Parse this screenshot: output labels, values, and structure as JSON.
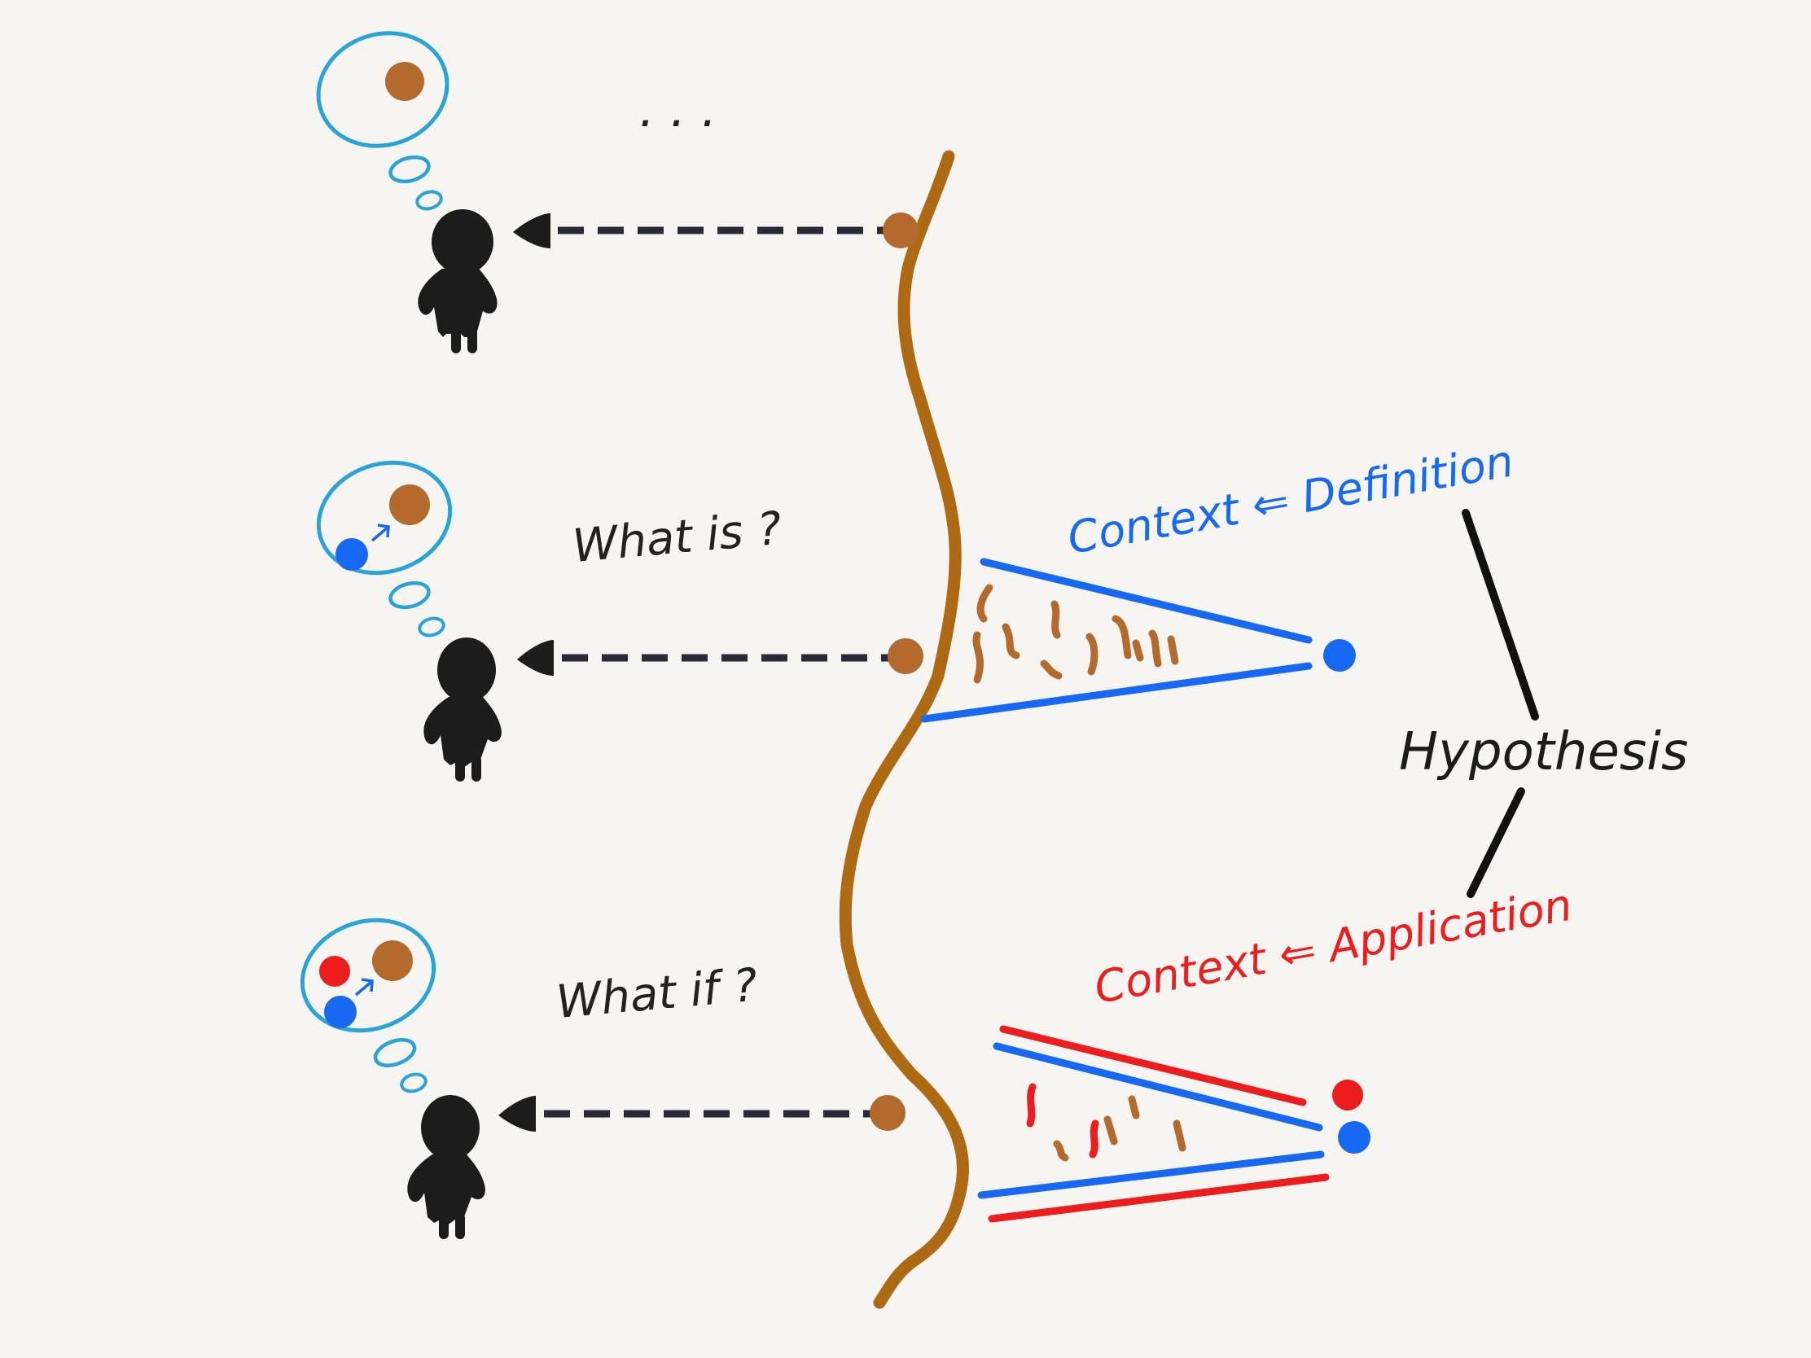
{
  "colors": {
    "background": "#f6f5f1",
    "river": "#ad6a12",
    "dot_brown": "#b36a2c",
    "blue": "#1768f2",
    "red": "#ee1d1d",
    "bubble": "#2aa3d8",
    "figure": "#1c1c1c",
    "arrow": "#2a2a36"
  },
  "labels": {
    "ellipsis": ". . .",
    "what_is": "What is ?",
    "what_if": "What if ?",
    "context_definition": "Context ⇐ Definition",
    "hypothesis": "Hypothesis",
    "context_application": "Context ⇐ Application"
  },
  "rows": [
    {
      "id": "top",
      "bubble_dots": [
        "dot_brown"
      ]
    },
    {
      "id": "middle",
      "bubble_dots": [
        "dot_brown",
        "blue"
      ]
    },
    {
      "id": "bottom",
      "bubble_dots": [
        "dot_brown",
        "blue",
        "red"
      ]
    }
  ],
  "icons": [
    "person-icon",
    "eye-icon",
    "thought-bubble-icon",
    "arrow-icon"
  ]
}
